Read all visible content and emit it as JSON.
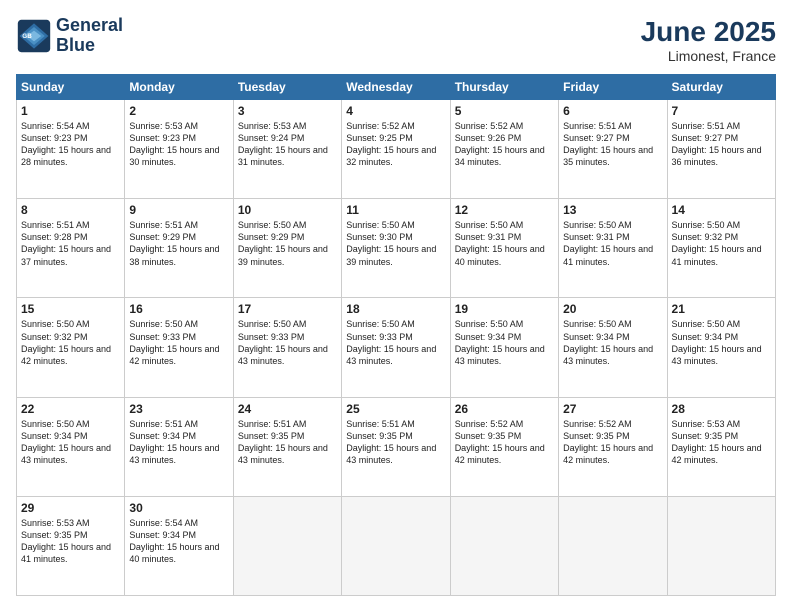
{
  "logo": {
    "line1": "General",
    "line2": "Blue"
  },
  "title": "June 2025",
  "subtitle": "Limonest, France",
  "weekdays": [
    "Sunday",
    "Monday",
    "Tuesday",
    "Wednesday",
    "Thursday",
    "Friday",
    "Saturday"
  ],
  "days": [
    {
      "num": "",
      "empty": true
    },
    {
      "num": "",
      "empty": true
    },
    {
      "num": "",
      "empty": true
    },
    {
      "num": "",
      "empty": true
    },
    {
      "num": "",
      "empty": true
    },
    {
      "num": "",
      "empty": true
    },
    {
      "num": "1",
      "sunrise": "5:54 AM",
      "sunset": "9:23 PM",
      "daylight": "15 hours and 28 minutes."
    },
    {
      "num": "2",
      "sunrise": "5:53 AM",
      "sunset": "9:23 PM",
      "daylight": "15 hours and 30 minutes."
    },
    {
      "num": "3",
      "sunrise": "5:53 AM",
      "sunset": "9:24 PM",
      "daylight": "15 hours and 31 minutes."
    },
    {
      "num": "4",
      "sunrise": "5:52 AM",
      "sunset": "9:25 PM",
      "daylight": "15 hours and 32 minutes."
    },
    {
      "num": "5",
      "sunrise": "5:52 AM",
      "sunset": "9:26 PM",
      "daylight": "15 hours and 34 minutes."
    },
    {
      "num": "6",
      "sunrise": "5:51 AM",
      "sunset": "9:27 PM",
      "daylight": "15 hours and 35 minutes."
    },
    {
      "num": "7",
      "sunrise": "5:51 AM",
      "sunset": "9:27 PM",
      "daylight": "15 hours and 36 minutes."
    },
    {
      "num": "8",
      "sunrise": "5:51 AM",
      "sunset": "9:28 PM",
      "daylight": "15 hours and 37 minutes."
    },
    {
      "num": "9",
      "sunrise": "5:51 AM",
      "sunset": "9:29 PM",
      "daylight": "15 hours and 38 minutes."
    },
    {
      "num": "10",
      "sunrise": "5:50 AM",
      "sunset": "9:29 PM",
      "daylight": "15 hours and 39 minutes."
    },
    {
      "num": "11",
      "sunrise": "5:50 AM",
      "sunset": "9:30 PM",
      "daylight": "15 hours and 39 minutes."
    },
    {
      "num": "12",
      "sunrise": "5:50 AM",
      "sunset": "9:31 PM",
      "daylight": "15 hours and 40 minutes."
    },
    {
      "num": "13",
      "sunrise": "5:50 AM",
      "sunset": "9:31 PM",
      "daylight": "15 hours and 41 minutes."
    },
    {
      "num": "14",
      "sunrise": "5:50 AM",
      "sunset": "9:32 PM",
      "daylight": "15 hours and 41 minutes."
    },
    {
      "num": "15",
      "sunrise": "5:50 AM",
      "sunset": "9:32 PM",
      "daylight": "15 hours and 42 minutes."
    },
    {
      "num": "16",
      "sunrise": "5:50 AM",
      "sunset": "9:33 PM",
      "daylight": "15 hours and 42 minutes."
    },
    {
      "num": "17",
      "sunrise": "5:50 AM",
      "sunset": "9:33 PM",
      "daylight": "15 hours and 43 minutes."
    },
    {
      "num": "18",
      "sunrise": "5:50 AM",
      "sunset": "9:33 PM",
      "daylight": "15 hours and 43 minutes."
    },
    {
      "num": "19",
      "sunrise": "5:50 AM",
      "sunset": "9:34 PM",
      "daylight": "15 hours and 43 minutes."
    },
    {
      "num": "20",
      "sunrise": "5:50 AM",
      "sunset": "9:34 PM",
      "daylight": "15 hours and 43 minutes."
    },
    {
      "num": "21",
      "sunrise": "5:50 AM",
      "sunset": "9:34 PM",
      "daylight": "15 hours and 43 minutes."
    },
    {
      "num": "22",
      "sunrise": "5:50 AM",
      "sunset": "9:34 PM",
      "daylight": "15 hours and 43 minutes."
    },
    {
      "num": "23",
      "sunrise": "5:51 AM",
      "sunset": "9:34 PM",
      "daylight": "15 hours and 43 minutes."
    },
    {
      "num": "24",
      "sunrise": "5:51 AM",
      "sunset": "9:35 PM",
      "daylight": "15 hours and 43 minutes."
    },
    {
      "num": "25",
      "sunrise": "5:51 AM",
      "sunset": "9:35 PM",
      "daylight": "15 hours and 43 minutes."
    },
    {
      "num": "26",
      "sunrise": "5:52 AM",
      "sunset": "9:35 PM",
      "daylight": "15 hours and 42 minutes."
    },
    {
      "num": "27",
      "sunrise": "5:52 AM",
      "sunset": "9:35 PM",
      "daylight": "15 hours and 42 minutes."
    },
    {
      "num": "28",
      "sunrise": "5:53 AM",
      "sunset": "9:35 PM",
      "daylight": "15 hours and 42 minutes."
    },
    {
      "num": "29",
      "sunrise": "5:53 AM",
      "sunset": "9:35 PM",
      "daylight": "15 hours and 41 minutes."
    },
    {
      "num": "30",
      "sunrise": "5:54 AM",
      "sunset": "9:34 PM",
      "daylight": "15 hours and 40 minutes."
    },
    {
      "num": "",
      "empty": true
    },
    {
      "num": "",
      "empty": true
    },
    {
      "num": "",
      "empty": true
    },
    {
      "num": "",
      "empty": true
    },
    {
      "num": "",
      "empty": true
    }
  ]
}
